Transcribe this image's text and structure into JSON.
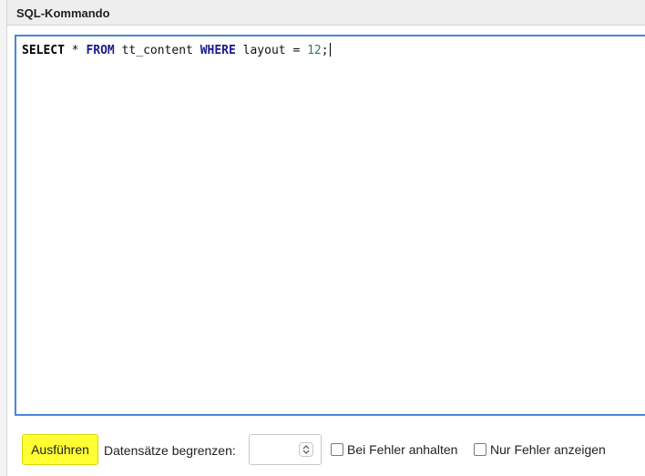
{
  "panel": {
    "title": "SQL-Kommando"
  },
  "editor": {
    "tokens": {
      "select": "SELECT",
      "star": " * ",
      "from": "FROM",
      "table": " tt_content ",
      "where": "WHERE",
      "condition": " layout = ",
      "number": "12",
      "semicolon": ";"
    }
  },
  "toolbar": {
    "run_label": "Ausführen",
    "limit_label": "Datensätze begrenzen:",
    "limit_value": "",
    "stop_on_error_label": "Bei Fehler anhalten",
    "only_errors_label": "Nur Fehler anzeigen"
  },
  "colors": {
    "run_button": "#ffff33",
    "editor_border": "#4a86d4"
  }
}
